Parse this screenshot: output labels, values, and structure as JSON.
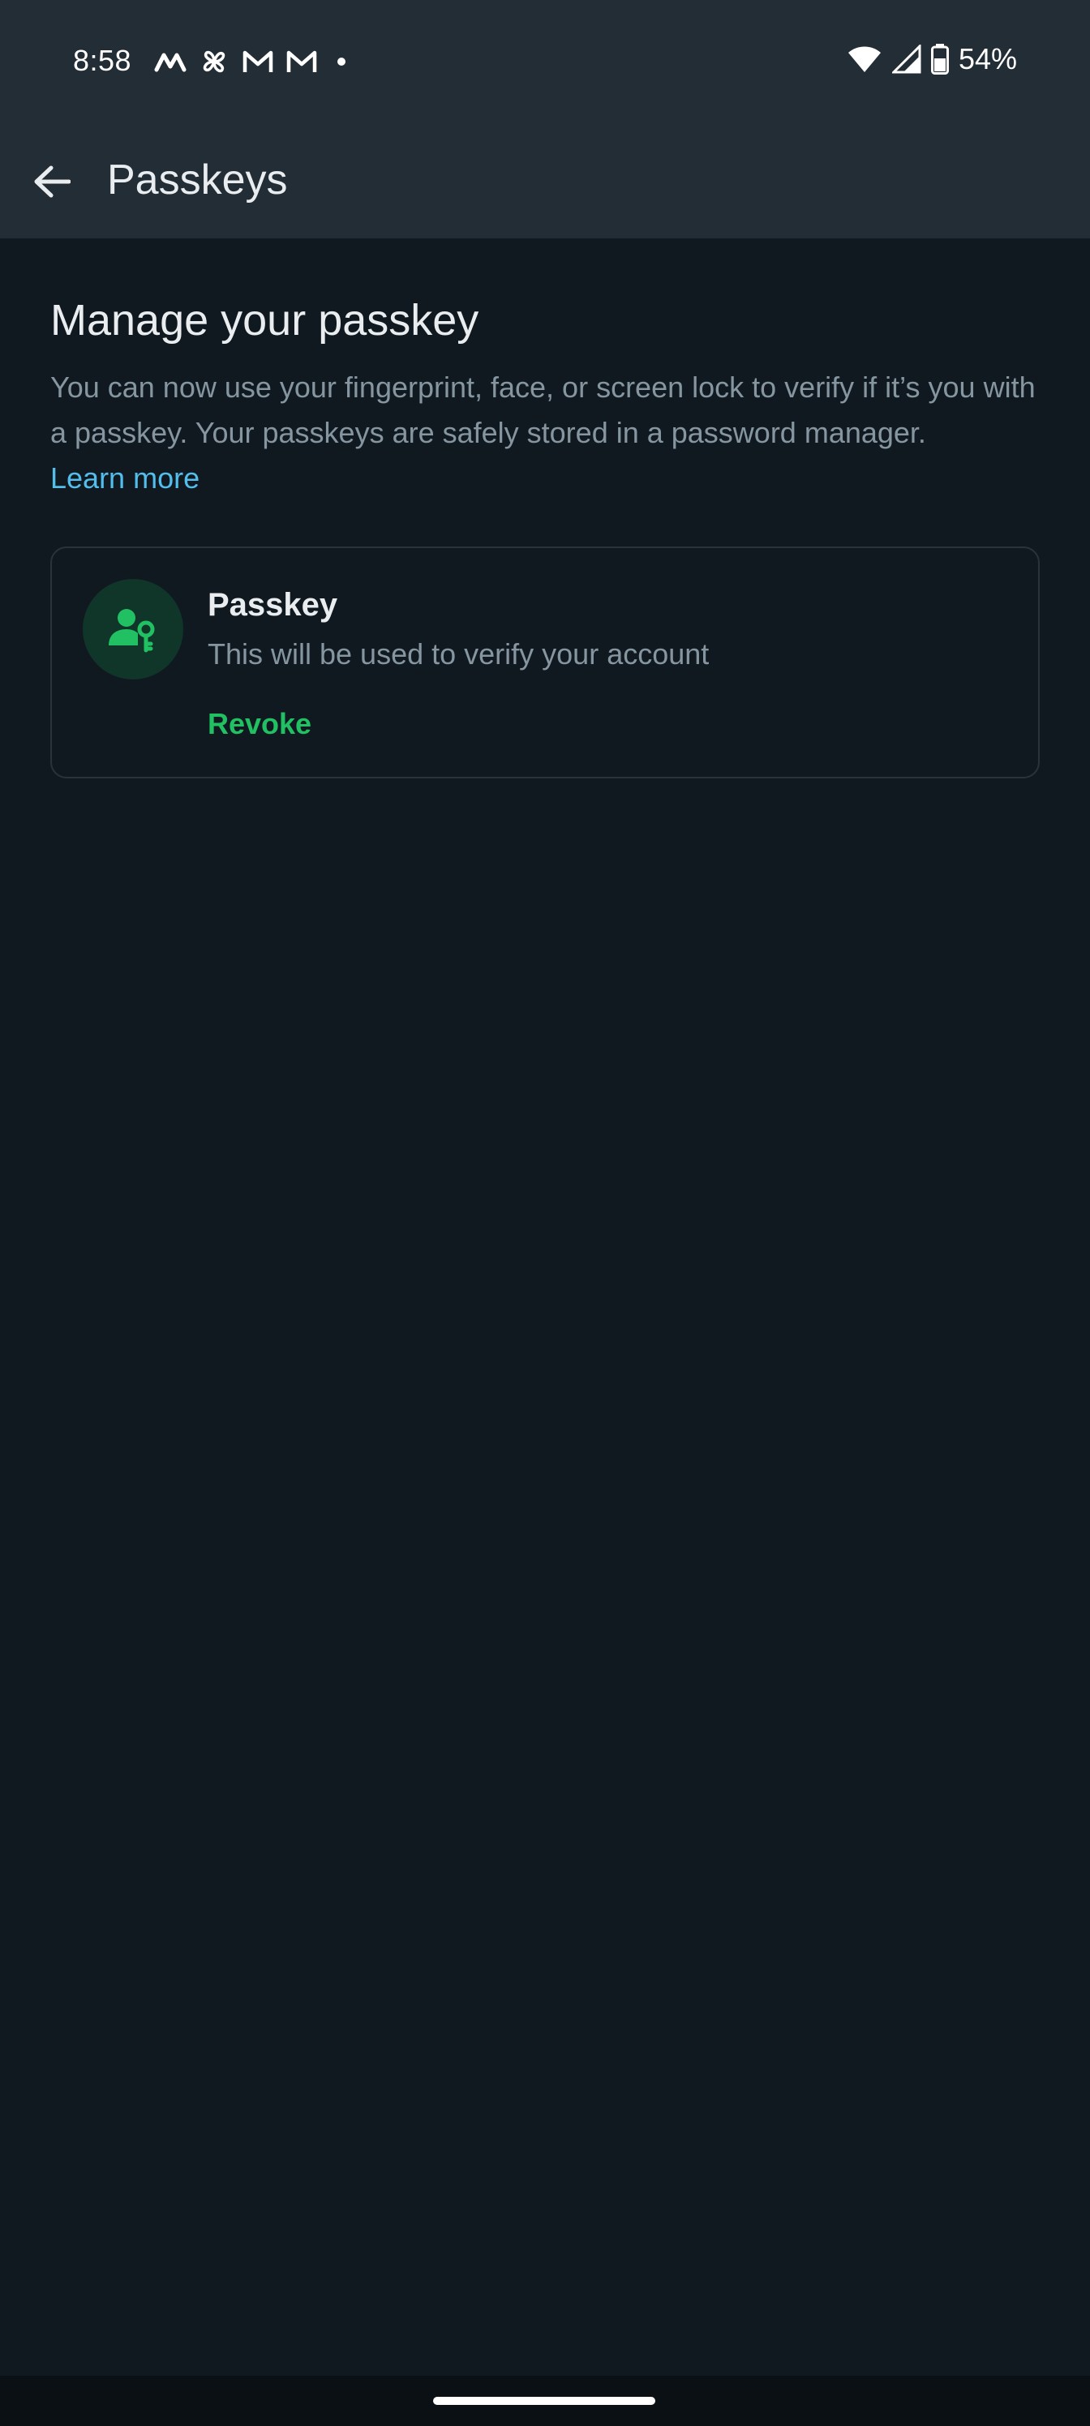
{
  "status_bar": {
    "time": "8:58",
    "notification_icons": [
      "maps-icon",
      "pinwheel-icon",
      "gmail-icon",
      "gmail-icon",
      "more-dot-icon"
    ],
    "battery_text": "54%",
    "battery_level_fraction": 0.54
  },
  "app_bar": {
    "title": "Passkeys",
    "back_icon": "arrow-back-icon"
  },
  "main": {
    "title": "Manage your passkey",
    "description": "You can now use your fingerprint, face, or screen lock to verify if it’s you with a passkey. Your passkeys are safely stored in a password manager.",
    "learn_more": "Learn more",
    "passkey_card": {
      "icon": "person-key-icon",
      "title": "Passkey",
      "description": "This will be used to verify your account",
      "revoke_label": "Revoke"
    }
  },
  "colors": {
    "background": "#111920",
    "top_bar": "#232d36",
    "link_blue": "#53bdeb",
    "accent_green": "#21c063",
    "avatar_bg": "#103529",
    "secondary_text": "#8696a0"
  }
}
